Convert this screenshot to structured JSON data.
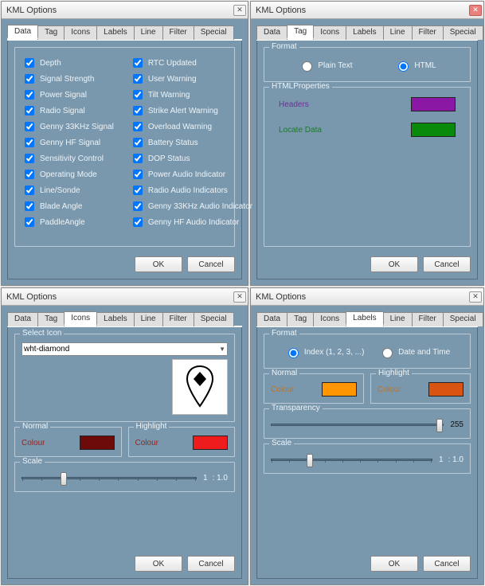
{
  "title": "KML Options",
  "tabs": [
    "Data",
    "Tag",
    "Icons",
    "Labels",
    "Line",
    "Filter",
    "Special"
  ],
  "buttons": {
    "ok": "OK",
    "cancel": "Cancel"
  },
  "dataTab": {
    "col1": [
      "Depth",
      "Signal Strength",
      "Power Signal",
      "Radio Signal",
      "Genny 33KHz Signal",
      "Genny HF Signal",
      "Sensitivity Control",
      "Operating Mode",
      "Line/Sonde",
      "Blade Angle",
      "PaddleAngle"
    ],
    "col2": [
      "RTC Updated",
      "User Warning",
      "Tilt Warning",
      "Strike Alert Warning",
      "Overload Warning",
      "Battery Status",
      "DOP Status",
      "Power Audio Indicator",
      "Radio Audio Indicators",
      "Genny 33KHz Audio Indicator",
      "Genny HF Audio Indicator"
    ]
  },
  "tagTab": {
    "formatTitle": "Format",
    "plain": "Plain Text",
    "html": "HTML",
    "propsTitle": "HTMLProperties",
    "headers": "Headers",
    "locate": "Locate Data",
    "headersColor": "#8a18a4",
    "locateColor": "#0a8a0a"
  },
  "iconsTab": {
    "selectTitle": "Select Icon",
    "selected": "wht-diamond",
    "normal": "Normal",
    "highlight": "Highlight",
    "colour": "Colour",
    "scale": "Scale",
    "scaleVal": "1",
    "scaleRatio": ": 1.0",
    "normalColor": "#6d0a0a",
    "highlightColor": "#ee1c1c"
  },
  "labelsTab": {
    "formatTitle": "Format",
    "indexOpt": "Index (1, 2, 3, ...)",
    "dateOpt": "Date and Time",
    "normal": "Normal",
    "highlight": "Highlight",
    "colour": "Colour",
    "transparency": "Transparency",
    "transVal": "255",
    "scale": "Scale",
    "scaleVal": "1",
    "scaleRatio": ": 1.0",
    "normalColor": "#ff9500",
    "highlightColor": "#d85410"
  }
}
